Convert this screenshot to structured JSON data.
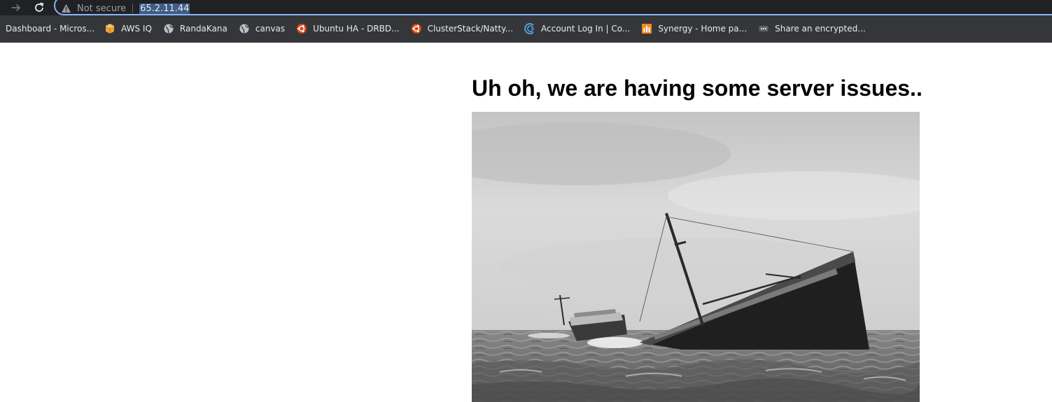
{
  "browser": {
    "security_label": "Not secure",
    "url": "65.2.11.44"
  },
  "bookmarks": [
    {
      "label": "Dashboard - Micros...",
      "icon": "microsoft-icon"
    },
    {
      "label": "AWS IQ",
      "icon": "aws-iq-icon"
    },
    {
      "label": "RandaKana",
      "icon": "globe-icon"
    },
    {
      "label": "canvas",
      "icon": "globe-icon"
    },
    {
      "label": "Ubuntu HA - DRBD...",
      "icon": "ubuntu-icon"
    },
    {
      "label": "ClusterStack/Natty...",
      "icon": "ubuntu-icon"
    },
    {
      "label": "Account Log In | Co...",
      "icon": "account-icon"
    },
    {
      "label": "Synergy - Home pa...",
      "icon": "synergy-icon"
    },
    {
      "label": "Share an encrypted...",
      "icon": "encrypted-share-icon"
    }
  ],
  "page": {
    "heading": "Uh oh, we are having some server issues..",
    "image": "sinking-ship-photo"
  },
  "colors": {
    "toolbar_bg": "#202124",
    "bookmarks_bg": "#35363a",
    "omnibox_border": "#8ab4f8",
    "url_highlight": "#3f5b86"
  }
}
